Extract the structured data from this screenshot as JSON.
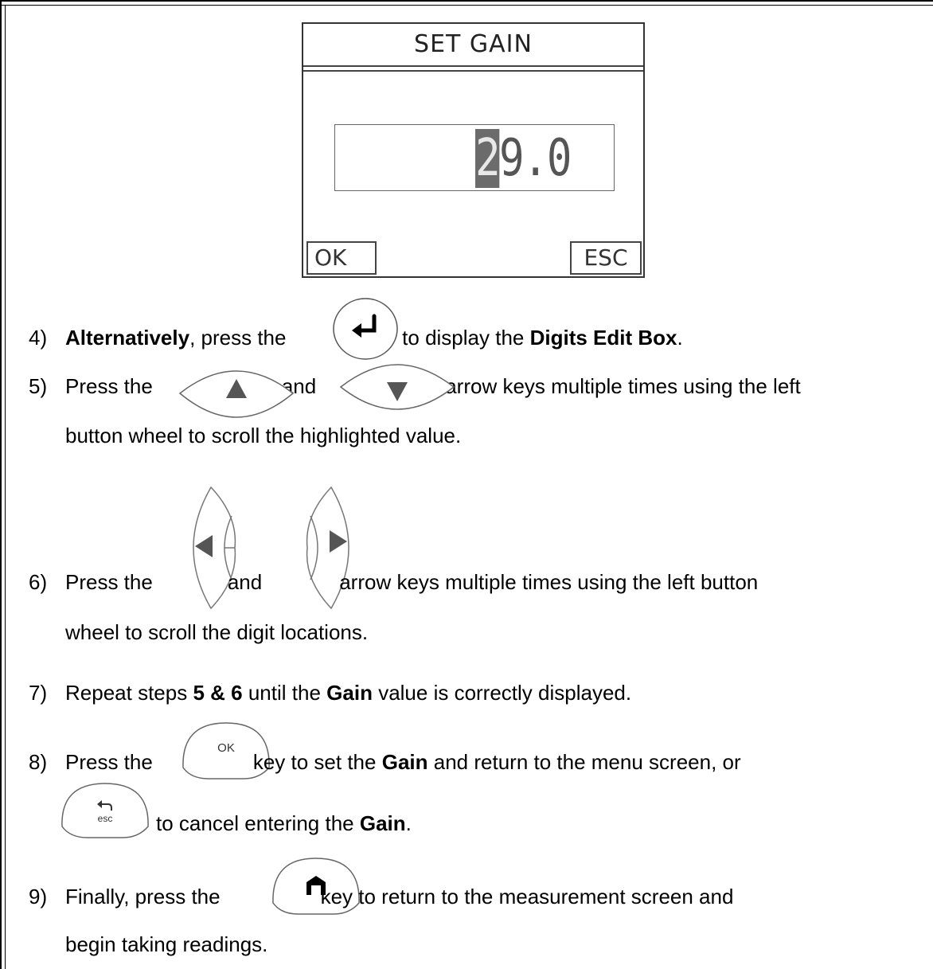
{
  "device": {
    "title": "SET GAIN",
    "value_highlight": "2",
    "value_rest": "9.0",
    "ok_label": "OK",
    "esc_label": "ESC"
  },
  "steps": {
    "s4": {
      "num": "4)",
      "bold1": "Alternatively",
      "t1": ", press the",
      "t2": "key to display the",
      "bold2": "Digits Edit Box",
      "t3": "."
    },
    "s5": {
      "num": "5)",
      "t1": "Press the",
      "t2": "and",
      "t3": "arrow keys multiple times using the left",
      "cont": "button wheel to scroll the highlighted value."
    },
    "s6": {
      "num": "6)",
      "t1": "Press the",
      "t2": "and",
      "t3": "arrow keys multiple times using the left button",
      "cont": "wheel to scroll the digit locations."
    },
    "s7": {
      "num": "7)",
      "t1": "Repeat steps",
      "bold1": "5 & 6",
      "t2": "until the",
      "bold2": "Gain",
      "t3": "value is correctly displayed."
    },
    "s8": {
      "num": "8)",
      "t1": "Press the",
      "t2": "key to set the",
      "bold1": "Gain",
      "t3": "and return to the menu screen, or",
      "t4": "to cancel entering the",
      "bold2": "Gain",
      "t5": "."
    },
    "s9": {
      "num": "9)",
      "t1": "Finally, press the",
      "t2": "key to return to the measurement screen and",
      "cont": "begin taking readings."
    }
  },
  "keys": {
    "ok_key_label": "OK",
    "esc_key_label": "esc"
  },
  "icons": {
    "enter": "enter-key-icon",
    "up": "up-arrow-key-icon",
    "down": "down-arrow-key-icon",
    "left": "left-arrow-key-icon",
    "right": "right-arrow-key-icon",
    "ok": "ok-key-icon",
    "esc": "esc-key-icon",
    "home": "home-key-icon"
  }
}
